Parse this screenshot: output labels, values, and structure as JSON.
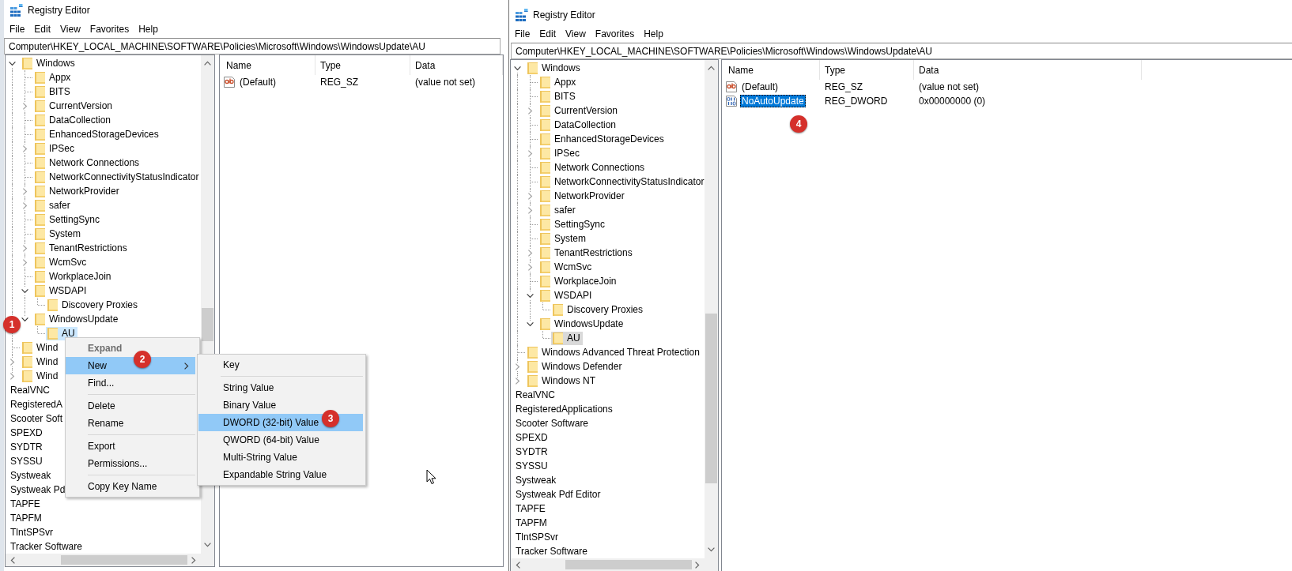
{
  "windows": [
    {
      "title": "Registry Editor",
      "menu": [
        "File",
        "Edit",
        "View",
        "Favorites",
        "Help"
      ],
      "address": "Computer\\HKEY_LOCAL_MACHINE\\SOFTWARE\\Policies\\Microsoft\\Windows\\WindowsUpdate\\AU",
      "tree_focused": true,
      "tree": [
        {
          "kind": "folder",
          "label": "Windows",
          "expandable": true,
          "expanded": true,
          "selected": false,
          "children": [
            {
              "kind": "folder",
              "label": "Appx",
              "expandable": false,
              "selected": false
            },
            {
              "kind": "folder",
              "label": "BITS",
              "expandable": false,
              "selected": false
            },
            {
              "kind": "folder",
              "label": "CurrentVersion",
              "expandable": true,
              "expanded": false,
              "selected": false
            },
            {
              "kind": "folder",
              "label": "DataCollection",
              "expandable": false,
              "selected": false
            },
            {
              "kind": "folder",
              "label": "EnhancedStorageDevices",
              "expandable": false,
              "selected": false
            },
            {
              "kind": "folder",
              "label": "IPSec",
              "expandable": true,
              "expanded": false,
              "selected": false
            },
            {
              "kind": "folder",
              "label": "Network Connections",
              "expandable": false,
              "selected": false
            },
            {
              "kind": "folder",
              "label": "NetworkConnectivityStatusIndicator",
              "expandable": false,
              "selected": false
            },
            {
              "kind": "folder",
              "label": "NetworkProvider",
              "expandable": true,
              "expanded": false,
              "selected": false
            },
            {
              "kind": "folder",
              "label": "safer",
              "expandable": true,
              "expanded": false,
              "selected": false
            },
            {
              "kind": "folder",
              "label": "SettingSync",
              "expandable": false,
              "selected": false
            },
            {
              "kind": "folder",
              "label": "System",
              "expandable": false,
              "selected": false
            },
            {
              "kind": "folder",
              "label": "TenantRestrictions",
              "expandable": true,
              "expanded": false,
              "selected": false
            },
            {
              "kind": "folder",
              "label": "WcmSvc",
              "expandable": true,
              "expanded": false,
              "selected": false
            },
            {
              "kind": "folder",
              "label": "WorkplaceJoin",
              "expandable": false,
              "selected": false
            },
            {
              "kind": "folder",
              "label": "WSDAPI",
              "expandable": true,
              "expanded": true,
              "selected": false,
              "children": [
                {
                  "kind": "folder",
                  "label": "Discovery Proxies",
                  "expandable": false,
                  "selected": false
                }
              ]
            },
            {
              "kind": "folder",
              "label": "WindowsUpdate",
              "expandable": true,
              "expanded": true,
              "selected": false,
              "badge": "1",
              "children": [
                {
                  "kind": "folder",
                  "label": "AU",
                  "expandable": false,
                  "selected": true
                }
              ]
            }
          ]
        },
        {
          "kind": "folder",
          "label": "Wind",
          "expandable": false,
          "selected": false
        },
        {
          "kind": "folder",
          "label": "Wind",
          "expandable": true,
          "expanded": false,
          "selected": false
        },
        {
          "kind": "folder",
          "label": "Wind",
          "expandable": true,
          "expanded": false,
          "selected": false
        },
        {
          "kind": "text",
          "label": "RealVNC",
          "selected": false
        },
        {
          "kind": "text",
          "label": "RegisteredA",
          "selected": false
        },
        {
          "kind": "text",
          "label": "Scooter Soft",
          "selected": false
        },
        {
          "kind": "text",
          "label": "SPEXD",
          "selected": false
        },
        {
          "kind": "text",
          "label": "SYDTR",
          "selected": false
        },
        {
          "kind": "text",
          "label": "SYSSU",
          "selected": false
        },
        {
          "kind": "text",
          "label": "Systweak",
          "selected": false
        },
        {
          "kind": "text",
          "label": "Systweak Pd",
          "selected": false
        },
        {
          "kind": "text",
          "label": "TAPFE",
          "selected": false
        },
        {
          "kind": "text",
          "label": "TAPFM",
          "selected": false
        },
        {
          "kind": "text",
          "label": "TlntSPSvr",
          "selected": false
        },
        {
          "kind": "text",
          "label": "Tracker Software",
          "selected": false
        }
      ],
      "columns": [
        "Name",
        "Type",
        "Data"
      ],
      "values": [
        {
          "kind": "string",
          "name": "(Default)",
          "type": "REG_SZ",
          "data": "(value not set)",
          "selected": false
        }
      ],
      "context_menu": {
        "items": [
          {
            "kind": "item",
            "label": "Expand",
            "disabled": true,
            "default": true,
            "selected": false,
            "submenu": false
          },
          {
            "kind": "item",
            "label": "New",
            "disabled": false,
            "default": false,
            "selected": true,
            "submenu": true,
            "badge": "2"
          },
          {
            "kind": "item",
            "label": "Find...",
            "disabled": false,
            "default": false,
            "selected": false,
            "submenu": false
          },
          {
            "kind": "separator"
          },
          {
            "kind": "item",
            "label": "Delete",
            "disabled": false,
            "default": false,
            "selected": false,
            "submenu": false
          },
          {
            "kind": "item",
            "label": "Rename",
            "disabled": false,
            "default": false,
            "selected": false,
            "submenu": false
          },
          {
            "kind": "separator"
          },
          {
            "kind": "item",
            "label": "Export",
            "disabled": false,
            "default": false,
            "selected": false,
            "submenu": false
          },
          {
            "kind": "item",
            "label": "Permissions...",
            "disabled": false,
            "default": false,
            "selected": false,
            "submenu": false
          },
          {
            "kind": "separator"
          },
          {
            "kind": "item",
            "label": "Copy Key Name",
            "disabled": false,
            "default": false,
            "selected": false,
            "submenu": false
          }
        ]
      },
      "submenu": {
        "items": [
          {
            "kind": "item",
            "label": "Key",
            "selected": false
          },
          {
            "kind": "separator"
          },
          {
            "kind": "item",
            "label": "String Value",
            "selected": false
          },
          {
            "kind": "item",
            "label": "Binary Value",
            "selected": false
          },
          {
            "kind": "item",
            "label": "DWORD (32-bit) Value",
            "selected": true,
            "badge": "3"
          },
          {
            "kind": "item",
            "label": "QWORD (64-bit) Value",
            "selected": false
          },
          {
            "kind": "item",
            "label": "Multi-String Value",
            "selected": false
          },
          {
            "kind": "item",
            "label": "Expandable String Value",
            "selected": false
          }
        ]
      }
    },
    {
      "title": "Registry Editor",
      "menu": [
        "File",
        "Edit",
        "View",
        "Favorites",
        "Help"
      ],
      "address": "Computer\\HKEY_LOCAL_MACHINE\\SOFTWARE\\Policies\\Microsoft\\Windows\\WindowsUpdate\\AU",
      "tree_focused": false,
      "tree": [
        {
          "kind": "folder",
          "label": "Windows",
          "expandable": true,
          "expanded": true,
          "selected": false,
          "children": [
            {
              "kind": "folder",
              "label": "Appx",
              "expandable": false,
              "selected": false
            },
            {
              "kind": "folder",
              "label": "BITS",
              "expandable": false,
              "selected": false
            },
            {
              "kind": "folder",
              "label": "CurrentVersion",
              "expandable": true,
              "expanded": false,
              "selected": false
            },
            {
              "kind": "folder",
              "label": "DataCollection",
              "expandable": false,
              "selected": false
            },
            {
              "kind": "folder",
              "label": "EnhancedStorageDevices",
              "expandable": false,
              "selected": false
            },
            {
              "kind": "folder",
              "label": "IPSec",
              "expandable": true,
              "expanded": false,
              "selected": false
            },
            {
              "kind": "folder",
              "label": "Network Connections",
              "expandable": false,
              "selected": false
            },
            {
              "kind": "folder",
              "label": "NetworkConnectivityStatusIndicator",
              "expandable": false,
              "selected": false
            },
            {
              "kind": "folder",
              "label": "NetworkProvider",
              "expandable": true,
              "expanded": false,
              "selected": false
            },
            {
              "kind": "folder",
              "label": "safer",
              "expandable": true,
              "expanded": false,
              "selected": false
            },
            {
              "kind": "folder",
              "label": "SettingSync",
              "expandable": false,
              "selected": false
            },
            {
              "kind": "folder",
              "label": "System",
              "expandable": false,
              "selected": false
            },
            {
              "kind": "folder",
              "label": "TenantRestrictions",
              "expandable": true,
              "expanded": false,
              "selected": false
            },
            {
              "kind": "folder",
              "label": "WcmSvc",
              "expandable": true,
              "expanded": false,
              "selected": false
            },
            {
              "kind": "folder",
              "label": "WorkplaceJoin",
              "expandable": false,
              "selected": false
            },
            {
              "kind": "folder",
              "label": "WSDAPI",
              "expandable": true,
              "expanded": true,
              "selected": false,
              "children": [
                {
                  "kind": "folder",
                  "label": "Discovery Proxies",
                  "expandable": false,
                  "selected": false
                }
              ]
            },
            {
              "kind": "folder",
              "label": "WindowsUpdate",
              "expandable": true,
              "expanded": true,
              "selected": false,
              "children": [
                {
                  "kind": "folder",
                  "label": "AU",
                  "expandable": false,
                  "selected": true
                }
              ]
            }
          ]
        },
        {
          "kind": "folder",
          "label": "Windows Advanced Threat Protection",
          "expandable": false,
          "selected": false
        },
        {
          "kind": "folder",
          "label": "Windows Defender",
          "expandable": true,
          "expanded": false,
          "selected": false
        },
        {
          "kind": "folder",
          "label": "Windows NT",
          "expandable": true,
          "expanded": false,
          "selected": false
        },
        {
          "kind": "text",
          "label": "RealVNC",
          "selected": false
        },
        {
          "kind": "text",
          "label": "RegisteredApplications",
          "selected": false
        },
        {
          "kind": "text",
          "label": "Scooter Software",
          "selected": false
        },
        {
          "kind": "text",
          "label": "SPEXD",
          "selected": false
        },
        {
          "kind": "text",
          "label": "SYDTR",
          "selected": false
        },
        {
          "kind": "text",
          "label": "SYSSU",
          "selected": false
        },
        {
          "kind": "text",
          "label": "Systweak",
          "selected": false
        },
        {
          "kind": "text",
          "label": "Systweak Pdf Editor",
          "selected": false
        },
        {
          "kind": "text",
          "label": "TAPFE",
          "selected": false
        },
        {
          "kind": "text",
          "label": "TAPFM",
          "selected": false
        },
        {
          "kind": "text",
          "label": "TlntSPSvr",
          "selected": false
        },
        {
          "kind": "text",
          "label": "Tracker Software",
          "selected": false
        }
      ],
      "columns": [
        "Name",
        "Type",
        "Data"
      ],
      "values": [
        {
          "kind": "string",
          "name": "(Default)",
          "type": "REG_SZ",
          "data": "(value not set)",
          "selected": false
        },
        {
          "kind": "dword",
          "name": "NoAutoUpdate",
          "type": "REG_DWORD",
          "data": "0x00000000 (0)",
          "selected": true,
          "badge": "4"
        }
      ]
    }
  ]
}
